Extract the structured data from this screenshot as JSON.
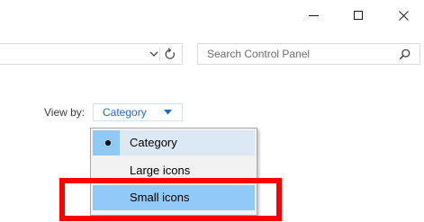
{
  "window": {
    "minimize_icon": "minimize-icon",
    "maximize_icon": "maximize-icon",
    "close_icon": "close-icon"
  },
  "address_bar": {
    "dropdown_icon": "chevron-down-icon",
    "refresh_icon": "refresh-icon"
  },
  "search": {
    "placeholder": "Search Control Panel",
    "icon": "search-icon"
  },
  "view_by": {
    "label": "View by:",
    "selected": "Category",
    "arrow_icon": "dropdown-arrow-icon"
  },
  "menu": {
    "items": [
      {
        "label": "Category",
        "checked": true
      },
      {
        "label": "Large icons",
        "checked": false
      },
      {
        "label": "Small icons",
        "checked": false,
        "hovered": true
      }
    ]
  },
  "colors": {
    "highlight": "#ff0000",
    "hover": "#91c9f7",
    "link": "#1a6bc7"
  }
}
